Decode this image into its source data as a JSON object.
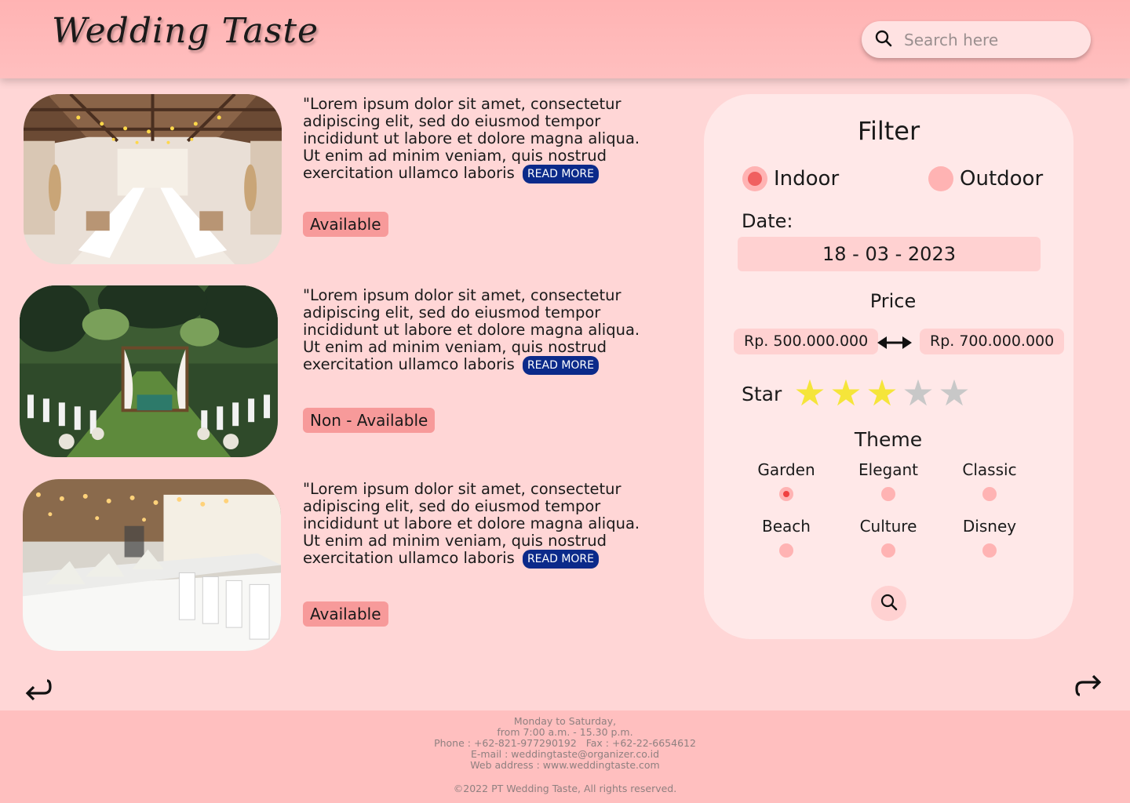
{
  "header": {
    "logo_text": "Wedding Taste",
    "search": {
      "placeholder": "Search here",
      "icon": "search-icon"
    }
  },
  "listings": [
    {
      "image": "rustic barn wedding hall with string lights",
      "description": "\"Lorem ipsum dolor sit amet, consectetur adipiscing elit, sed do eiusmod tempor incididunt ut labore et dolore magna aliqua. Ut enim ad minim veniam, quis nostrud exercitation ullamco laboris",
      "read_more": "READ MORE",
      "status": "Available"
    },
    {
      "image": "outdoor garden wedding with draped arch",
      "description": "\"Lorem ipsum dolor sit amet, consectetur adipiscing elit, sed do eiusmod tempor incididunt ut labore et dolore magna aliqua. Ut enim ad minim veniam, quis nostrud exercitation ullamco laboris",
      "read_more": "READ MORE",
      "status": "Non - Available"
    },
    {
      "image": "banquet hall with white table settings",
      "description": "\"Lorem ipsum dolor sit amet, consectetur adipiscing elit, sed do eiusmod tempor incididunt ut labore et dolore magna aliqua. Ut enim ad minim veniam, quis nostrud exercitation ullamco laboris",
      "read_more": "READ MORE",
      "status": "Available"
    }
  ],
  "filter": {
    "title": "Filter",
    "venue_type": {
      "options": [
        "Indoor",
        "Outdoor"
      ],
      "selected": "Indoor"
    },
    "date": {
      "label": "Date:",
      "value": "18 - 03 - 2023"
    },
    "price": {
      "label": "Price",
      "min": "Rp. 500.000.000",
      "max": "Rp. 700.000.000"
    },
    "star": {
      "label": "Star",
      "rating": 3,
      "max": 5
    },
    "theme": {
      "label": "Theme",
      "options": [
        "Garden",
        "Elegant",
        "Classic",
        "Beach",
        "Culture",
        "Disney"
      ],
      "selected": "Garden"
    },
    "search_button_icon": "search-icon"
  },
  "pagination": {
    "prev_icon": "back-arrow-icon",
    "next_icon": "forward-arrow-icon"
  },
  "footer": {
    "hours_1": "Monday to Saturday,",
    "hours_2": "from 7:00 a.m. - 15.30 p.m.",
    "phone": "Phone : +62-821-977290192   Fax : +62-22-6654612",
    "email": "E-mail : weddingtaste@organizer.co.id",
    "web": "Web address : www.weddingtaste.com",
    "copyright": "©2022 PT Wedding Taste, All rights reserved."
  },
  "colors": {
    "background": "#ffd6d6",
    "header": "#ffb3b3",
    "panel": "#ffe8e8",
    "status_badge": "#f79a9a",
    "read_more": "#0b2a8a",
    "star_filled": "#f5e53a",
    "star_empty": "#c8c8c8"
  }
}
